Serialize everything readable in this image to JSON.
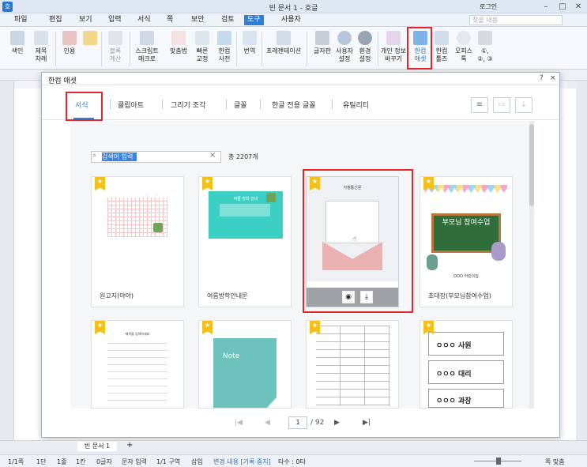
{
  "window": {
    "title": "빈 문서 1 - 호글",
    "app_icon": "호",
    "login": "로그인",
    "search_placeholder": "찾을 내용"
  },
  "menu": [
    "파일",
    "편집",
    "보기",
    "입력",
    "서식",
    "쪽",
    "보안",
    "검토",
    "도구",
    "사용자"
  ],
  "menu_active": "도구",
  "ribbon": [
    {
      "label": "색인",
      "sub": ""
    },
    {
      "label": "제목",
      "sub": "차례"
    },
    {
      "label": "인용",
      "sub": ""
    },
    {
      "label": "",
      "sub": ""
    },
    {
      "label": "블록",
      "sub": "계산"
    },
    {
      "label": "스크립트",
      "sub": "매크로"
    },
    {
      "label": "맞춤법",
      "sub": ""
    },
    {
      "label": "빠른",
      "sub": "교정"
    },
    {
      "label": "한컴",
      "sub": "사전"
    },
    {
      "label": "번역",
      "sub": ""
    },
    {
      "label": "프레젠테이션",
      "sub": ""
    },
    {
      "label": "글자판",
      "sub": ""
    },
    {
      "label": "사용자",
      "sub": "설정"
    },
    {
      "label": "환경",
      "sub": "설정"
    },
    {
      "label": "개인 정보",
      "sub": "바꾸기"
    },
    {
      "label": "한컴",
      "sub": "애셋"
    },
    {
      "label": "한컴",
      "sub": "툴즈"
    },
    {
      "label": "오피스",
      "sub": "톡"
    },
    {
      "label": "①,",
      "sub": "②, ③"
    }
  ],
  "dialog": {
    "title": "한컴 애셋",
    "help": "?",
    "close": "×",
    "tabs": [
      "서식",
      "클립아트",
      "그리기 조각",
      "글꼴",
      "한글 전용 글꼴",
      "유틸리티"
    ],
    "search_placeholder": "검색어 입력",
    "total": "총 2207개",
    "cards": [
      {
        "name": "원고지(야야)"
      },
      {
        "name": "여름방학안내문",
        "thumb_title": "여름 방학 안내"
      },
      {
        "name": "",
        "thumb_title": "가정통신문"
      },
      {
        "name": "초대장(부모님참여수업)",
        "thumb_title": "부모님 참여수업",
        "thumb_sub": "OOO 어린이집"
      },
      {
        "name": "",
        "thumb_title": "제목을 입력하세요"
      },
      {
        "name": "",
        "thumb_title": "Note"
      },
      {
        "name": ""
      },
      {
        "name": "",
        "thumb_rows": [
          "ㅇㅇㅇ 사원",
          "ㅇㅇㅇ 대리",
          "ㅇㅇㅇ 과장"
        ]
      }
    ],
    "pager": {
      "current": "1",
      "total": "/ 92"
    }
  },
  "doc_tab": "빈 문서 1",
  "status": [
    "1/1쪽",
    "1단",
    "1줄",
    "1칸",
    "0글자",
    "문자 입력",
    "1/1 구역",
    "삽입",
    "변경 내용 [기록 중지]",
    "타수 : 0타"
  ],
  "zoom": "쪽 맞춤",
  "colors": {
    "accent": "#2f7fd6",
    "highlight": "#e0282e",
    "star": "#f3c21a",
    "teal": "#3ccfc4",
    "board": "#2f6e3b"
  }
}
